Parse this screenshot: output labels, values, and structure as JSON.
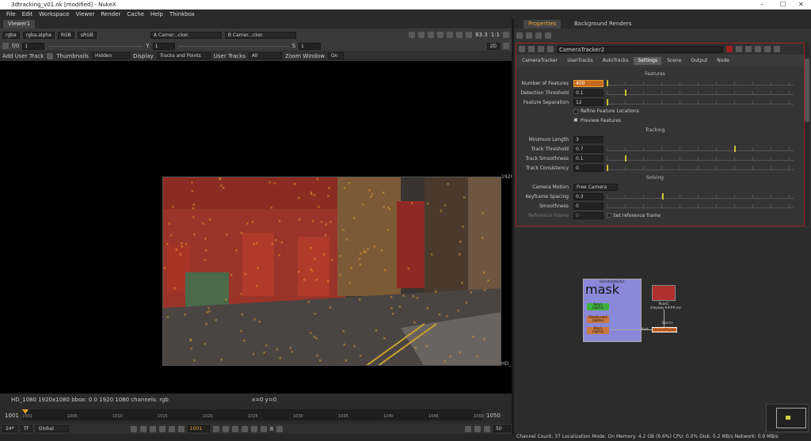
{
  "window": {
    "title": "3dtracking_v01.nk [modified] - NukeX"
  },
  "menu": [
    "File",
    "Edit",
    "Workspace",
    "Viewer",
    "Render",
    "Cache",
    "Help",
    "Thinkbox"
  ],
  "viewer": {
    "tab": "Viewer1",
    "channels": "rgba",
    "alpha": "rgba.alpha",
    "colorspace_a": "RGB",
    "colorspace_b": "sRGB",
    "input_a": "Camer...cker.",
    "input_b": "Camer...cker.",
    "zoom": "83.3",
    "ratio": "1:1",
    "view_mode": "2D",
    "f_stop": "f/0",
    "gain": "1",
    "gamma_label": "Y",
    "gamma": "1",
    "sat_label": "S",
    "sat": "1",
    "overlay": {
      "add_user_track": "Add User Track",
      "thumbnails_label": "Thumbnails",
      "thumbnails": "Hidden",
      "display_label": "Display",
      "display": "Tracks and Points",
      "user_tracks_label": "User Tracks",
      "user_tracks": "All",
      "zoom_window_label": "Zoom Window",
      "zoom_window": "On"
    },
    "res_label": "1920",
    "format_label": "HD_",
    "status_left": "HD_1080 1920x1080  bbox: 0 0 1920 1080 channels: rgb",
    "status_xy": "x=0 y=0"
  },
  "timeline": {
    "start": "1001",
    "end": "1050",
    "current": "1001",
    "ticks": [
      "1001",
      "1005",
      "1010",
      "1015",
      "1020",
      "1025",
      "1030",
      "1035",
      "1040",
      "1045",
      "1050"
    ],
    "fps": "24*",
    "tf": "TF",
    "scope": "Global",
    "frame": "1001",
    "step": "8",
    "inc": "50"
  },
  "properties": {
    "tabs": [
      "Properties",
      "Background Renders"
    ],
    "node_name": "CameraTracker2",
    "node_tabs": [
      "CameraTracker",
      "UserTracks",
      "AutoTracks",
      "Settings",
      "Scene",
      "Output",
      "Node"
    ],
    "active_tab": "Settings",
    "sections": {
      "features": "Features",
      "tracking": "Tracking",
      "solving": "Solving"
    },
    "fields": [
      {
        "label": "Number of Features",
        "value": "400",
        "knob": 0
      },
      {
        "label": "Detection Threshold",
        "value": "0.1",
        "knob": 0.1
      },
      {
        "label": "Feature Separation",
        "value": "12",
        "knob": 0
      }
    ],
    "refine": "Refine Feature Locations",
    "preview": "Preview Features",
    "tracking_fields": [
      {
        "label": "Minimum Length",
        "value": "3"
      },
      {
        "label": "Track Threshold",
        "value": "0.7",
        "knob": 0.7
      },
      {
        "label": "Track Smoothness",
        "value": "0.1",
        "knob": 0.1
      },
      {
        "label": "Track Consistency",
        "value": "0",
        "knob": 0
      }
    ],
    "camera_motion_label": "Camera Motion",
    "camera_motion": "Free Camera",
    "keyframe_label": "Keyframe Spacing",
    "keyframe": "0.3",
    "smoothness_label": "Smoothness",
    "smoothness": "0",
    "ref_frame_label": "Reference Frame",
    "ref_frame": "0",
    "set_ref": "Set reference frame",
    "slider_ticks": [
      "0.0",
      "0.05",
      "0.1",
      "0.15",
      "0.2",
      "0.25",
      "0.3",
      "0.35",
      "0.4",
      "0.45",
      "0.5"
    ]
  },
  "nodegraph": {
    "backdrop": "BackdropNode1",
    "mask": "mask",
    "nodes": [
      {
        "label": "Roto1",
        "sub": "(alpha)"
      },
      {
        "label": "FilterErode2",
        "sub": "(alpha)"
      },
      {
        "label": "Blur3",
        "sub": "(alpha)"
      }
    ],
    "read": "Read1",
    "read_file": "alleyway.####.exr",
    "tracker": "CameraTracker2",
    "source": "Source",
    "mask_pipe": "Mask"
  },
  "statusbar": "Channel Count: 37  Localization Mode: On  Memory: 4.2 GB (6.6%)  CPU: 0.0%  Disk: 0.2 MB/s  Network: 0.9 MB/s"
}
